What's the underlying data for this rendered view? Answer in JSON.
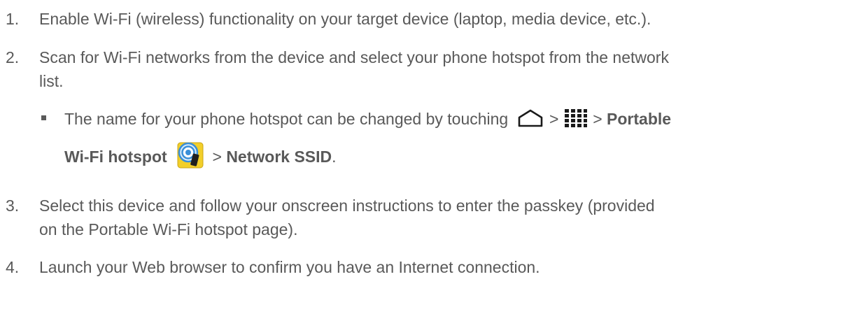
{
  "steps": [
    {
      "number": "1.",
      "text": "Enable Wi-Fi (wireless) functionality on your target device (laptop, media device, etc.)."
    },
    {
      "number": "2.",
      "line1": "Scan for Wi-Fi networks from the device and select your phone hotspot from the network",
      "line2": "list."
    },
    {
      "number": "3.",
      "line1": "Select this device and follow your onscreen instructions to enter the passkey (provided",
      "line2": "on the Portable Wi-Fi hotspot page)."
    },
    {
      "number": "4.",
      "text": "Launch your Web browser to confirm you have an Internet connection."
    }
  ],
  "bullet": {
    "prefix": "The name for your phone hotspot can be changed by touching",
    "sep1": ">",
    "sep2": ">",
    "item1": "Portable",
    "item2": "Wi-Fi hotspot",
    "sep3": ">",
    "item3": "Network SSID",
    "period": "."
  },
  "icons": [
    "home-icon",
    "apps-icon",
    "portable-wifi-hotspot-icon"
  ],
  "colors": {
    "text": "#595959",
    "icon_dark": "#1a1a1a",
    "hotspot_blue": "#3a8fd8",
    "hotspot_yellow": "#f2cf2a"
  }
}
